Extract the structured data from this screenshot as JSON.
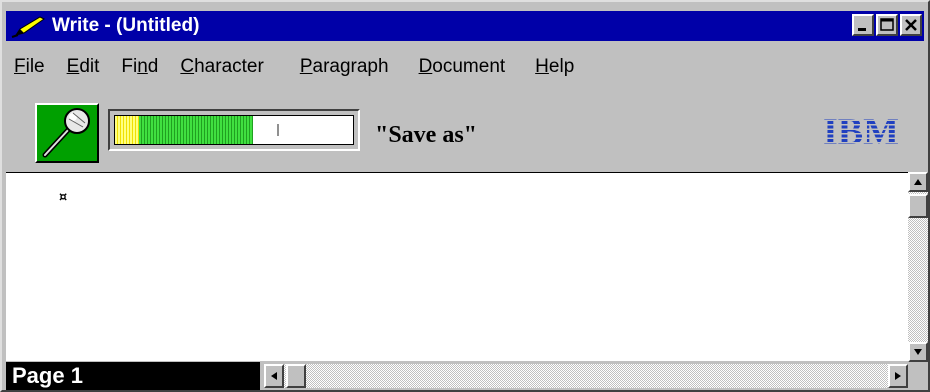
{
  "window": {
    "title": "Write - (Untitled)",
    "icon": "pen-icon",
    "controls": [
      "minimize-icon",
      "maximize-icon",
      "close-icon"
    ]
  },
  "menu": {
    "items": [
      {
        "label": "File",
        "accel": "F",
        "rest": "ile"
      },
      {
        "label": "Edit",
        "accel": "E",
        "rest": "dit"
      },
      {
        "label": "Find",
        "pre": "Fi",
        "accel": "n",
        "rest": "d"
      },
      {
        "label": "Character",
        "accel": "C",
        "rest": "haracter"
      },
      {
        "label": "Paragraph",
        "accel": "P",
        "rest": "aragraph"
      },
      {
        "label": "Document",
        "accel": "D",
        "rest": "ocument"
      },
      {
        "label": "Help",
        "accel": "H",
        "rest": "elp"
      }
    ]
  },
  "toolbar": {
    "mic_icon": "microphone-icon",
    "level_meter": {
      "level": 0.58,
      "peak": 0.68
    },
    "status_message": "\"Save as\"",
    "logo_text": "IBM",
    "colors": {
      "mic_button": "#00a000",
      "logo": "#2040c0",
      "meter_green": "#40e040",
      "meter_yellow": "#f0e000"
    }
  },
  "document": {
    "end_mark": "¤"
  },
  "status": {
    "page_label": "Page 1"
  },
  "colors": {
    "titlebar": "#0000a8",
    "chrome": "#c0c0c0"
  }
}
